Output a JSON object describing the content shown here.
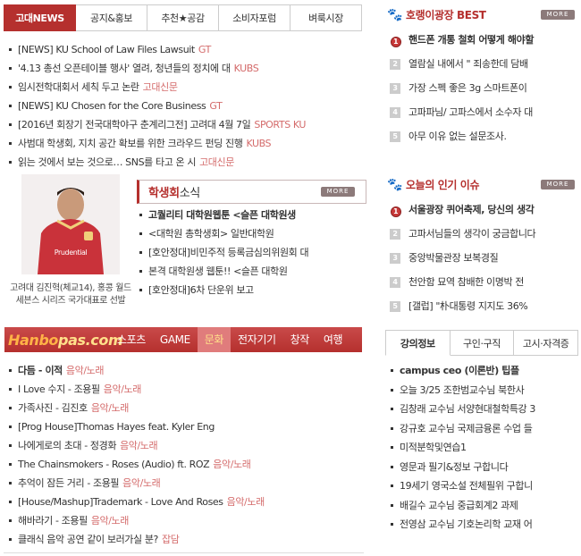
{
  "top_tabs": [
    "고대NEWS",
    "공지&홍보",
    "추천★공감",
    "소비자포럼",
    "벼룩시장"
  ],
  "news": [
    {
      "title": "[NEWS] KU School of Law Files Lawsuit",
      "source": "GT"
    },
    {
      "title": "'4.13 총선 오픈테이블 행사' 열려, 청년들의 정치에 대",
      "source": "KUBS"
    },
    {
      "title": "임시전학대회서 세칙 두고 논란",
      "source": "고대신문"
    },
    {
      "title": "[NEWS] KU Chosen for the Core Business",
      "source": "GT"
    },
    {
      "title": "[2016년 회장기 전국대학야구 춘계리그전] 고려대 4월 7일",
      "source": "SPORTS KU"
    },
    {
      "title": "사범대 학생회, 지치 공간 확보를 위한 크라우드 펀딩 진행",
      "source": "KUBS"
    },
    {
      "title": "읽는 것에서 보는 것으로… SNS를 타고 온 시",
      "source": "고대신문"
    }
  ],
  "council": {
    "title_bold": "학생회",
    "title_rest": "소식",
    "more": "MORE",
    "caption": "고려대 김진혁(체교14), 홍콩 월드 세븐스 시리즈 국가대표로 선발",
    "photo_text": "Prudential",
    "items": [
      "고퀄리티 대학원웹툰 <슬픈 대학원생",
      "<대학원 총학생회> 일반대학원",
      "[호안정대]비민주적 등록금심의위원회 대",
      "본격 대학원생 웹툰!! <슬픈 대학원",
      "[호안정대]6차 단운위 보고"
    ]
  },
  "music": {
    "logo_a": "Hanbo",
    "logo_b": "pas.com",
    "tabs": [
      "스포츠",
      "GAME",
      "문화",
      "전자기기",
      "창작",
      "여행"
    ],
    "active_tab": "문화",
    "items": [
      {
        "title": "다듬 - 이적",
        "cat": "음악/노래"
      },
      {
        "title": "I Love 수지 - 조용필",
        "cat": "음악/노래"
      },
      {
        "title": "가족사진 - 김진호",
        "cat": "음악/노래"
      },
      {
        "title": "[Prog House]Thomas Hayes feat. Kyler Eng",
        "cat": ""
      },
      {
        "title": "나에게로의 초대 - 정경화",
        "cat": "음악/노래"
      },
      {
        "title": "The Chainsmokers - Roses (Audio) ft. ROZ",
        "cat": "음악/노래"
      },
      {
        "title": "추억이 잠든 거리 - 조용필",
        "cat": "음악/노래"
      },
      {
        "title": "[House/Mashup]Trademark - Love And Roses",
        "cat": "음악/노래"
      },
      {
        "title": "해바라기 - 조용필",
        "cat": "음악/노래"
      },
      {
        "title": "클래식 음악 공연 같이 보러가실 분?",
        "cat": "잡담"
      }
    ]
  },
  "best": {
    "title": "호랭이광장 BEST",
    "more": "MORE",
    "items": [
      {
        "num": "1",
        "title": "핸드폰 개통 철회 어떻게 해야할"
      },
      {
        "num": "2",
        "title": "열람실 내에서 \" 죄송한데 담배"
      },
      {
        "num": "3",
        "title": "가장 스펙 좋은 3g 스마트폰이"
      },
      {
        "num": "4",
        "title": "고파파님/ 고파스에서 소수자 대"
      },
      {
        "num": "5",
        "title": "아무 이유 없는 설문조사."
      }
    ]
  },
  "popular": {
    "title": "오늘의 인기 이슈",
    "more": "MORE",
    "items": [
      {
        "num": "1",
        "title": "서울광장 퀴어축제, 당신의 생각"
      },
      {
        "num": "2",
        "title": "고파서님들의 생각이 궁금합니다"
      },
      {
        "num": "3",
        "title": "중앙박물관장 보복경질"
      },
      {
        "num": "4",
        "title": "천안함 묘역 참배한 이명박 전"
      },
      {
        "num": "5",
        "title": "[갤럽] \"朴대통령 지지도 36%"
      }
    ]
  },
  "lecture": {
    "tabs": [
      "강의정보",
      "구인·구직",
      "고시·자격증"
    ],
    "items": [
      "campus ceo (이론반) 팁플",
      "오늘 3/25 조한범교수님 북한사",
      "김창래 교수님 서양현대철학특강 3",
      "강규호 교수님 국제금융론 수업 들",
      "미적분학및연습1",
      "영문과 필기&정보 구합니다",
      "19세기 영국소설 전체필위 구합니",
      "배길수 교수님 중급회계2 과제",
      "전영삼 교수님 기호논리학 교재 어"
    ]
  }
}
